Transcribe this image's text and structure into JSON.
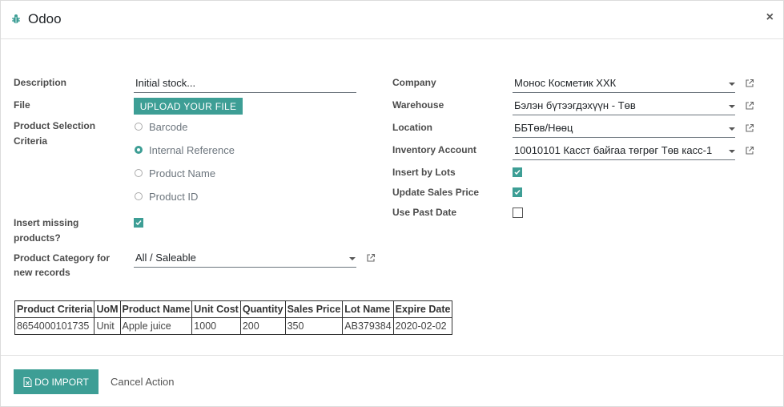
{
  "dialog": {
    "title": "Odoo",
    "close_glyph": "×",
    "icon": "bug-icon"
  },
  "left": {
    "description_label": "Description",
    "description_value": "Initial stock...",
    "file_label": "File",
    "upload_button": "UPLOAD YOUR FILE",
    "selection_label_line1": "Product Selection",
    "selection_label_line2": "Criteria",
    "selection_options": [
      {
        "label": "Barcode",
        "selected": false
      },
      {
        "label": "Internal Reference",
        "selected": true
      },
      {
        "label": "Product Name",
        "selected": false
      },
      {
        "label": "Product ID",
        "selected": false
      }
    ],
    "insert_missing_label_line1": "Insert missing",
    "insert_missing_label_line2": "products?",
    "insert_missing_checked": true,
    "category_label_line1": "Product Category for",
    "category_label_line2": "new records",
    "category_value": "All / Saleable"
  },
  "right": {
    "company_label": "Company",
    "company_value": "Монос Косметик ХХК",
    "warehouse_label": "Warehouse",
    "warehouse_value": "Бэлэн бүтээгдэхүүн - Төв",
    "location_label": "Location",
    "location_value": "ББТөв/Нөөц",
    "inventory_account_label": "Inventory Account",
    "inventory_account_value": "10010101 Касст байгаа төгрөг Төв касс-1",
    "insert_by_lots_label": "Insert by Lots",
    "insert_by_lots_checked": true,
    "update_sales_price_label": "Update Sales Price",
    "update_sales_price_checked": true,
    "use_past_date_label": "Use Past Date",
    "use_past_date_checked": false
  },
  "table": {
    "headers": [
      "Product Criteria",
      "UoM",
      "Product Name",
      "Unit Cost",
      "Quantity",
      "Sales Price",
      "Lot Name",
      "Expire Date"
    ],
    "rows": [
      [
        "8654000101735",
        "Unit",
        "Apple juice",
        "1000",
        "200",
        "350",
        "AB379384",
        "2020-02-02"
      ]
    ]
  },
  "footer": {
    "import_button": "DO IMPORT",
    "cancel_button": "Cancel Action"
  },
  "colors": {
    "accent": "#3d9e95"
  }
}
